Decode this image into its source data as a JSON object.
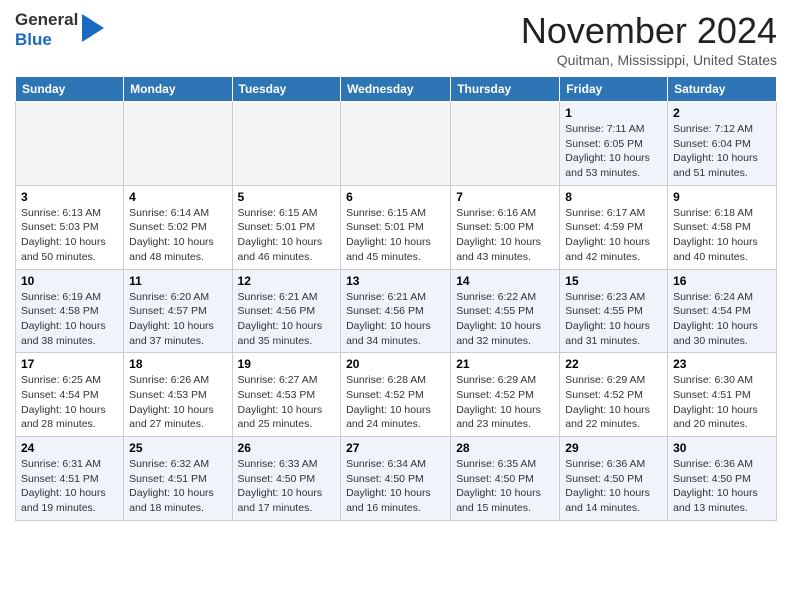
{
  "header": {
    "logo_general": "General",
    "logo_blue": "Blue",
    "month_title": "November 2024",
    "location": "Quitman, Mississippi, United States"
  },
  "days_of_week": [
    "Sunday",
    "Monday",
    "Tuesday",
    "Wednesday",
    "Thursday",
    "Friday",
    "Saturday"
  ],
  "weeks": [
    [
      {
        "day": "",
        "info": ""
      },
      {
        "day": "",
        "info": ""
      },
      {
        "day": "",
        "info": ""
      },
      {
        "day": "",
        "info": ""
      },
      {
        "day": "",
        "info": ""
      },
      {
        "day": "1",
        "info": "Sunrise: 7:11 AM\nSunset: 6:05 PM\nDaylight: 10 hours\nand 53 minutes."
      },
      {
        "day": "2",
        "info": "Sunrise: 7:12 AM\nSunset: 6:04 PM\nDaylight: 10 hours\nand 51 minutes."
      }
    ],
    [
      {
        "day": "3",
        "info": "Sunrise: 6:13 AM\nSunset: 5:03 PM\nDaylight: 10 hours\nand 50 minutes."
      },
      {
        "day": "4",
        "info": "Sunrise: 6:14 AM\nSunset: 5:02 PM\nDaylight: 10 hours\nand 48 minutes."
      },
      {
        "day": "5",
        "info": "Sunrise: 6:15 AM\nSunset: 5:01 PM\nDaylight: 10 hours\nand 46 minutes."
      },
      {
        "day": "6",
        "info": "Sunrise: 6:15 AM\nSunset: 5:01 PM\nDaylight: 10 hours\nand 45 minutes."
      },
      {
        "day": "7",
        "info": "Sunrise: 6:16 AM\nSunset: 5:00 PM\nDaylight: 10 hours\nand 43 minutes."
      },
      {
        "day": "8",
        "info": "Sunrise: 6:17 AM\nSunset: 4:59 PM\nDaylight: 10 hours\nand 42 minutes."
      },
      {
        "day": "9",
        "info": "Sunrise: 6:18 AM\nSunset: 4:58 PM\nDaylight: 10 hours\nand 40 minutes."
      }
    ],
    [
      {
        "day": "10",
        "info": "Sunrise: 6:19 AM\nSunset: 4:58 PM\nDaylight: 10 hours\nand 38 minutes."
      },
      {
        "day": "11",
        "info": "Sunrise: 6:20 AM\nSunset: 4:57 PM\nDaylight: 10 hours\nand 37 minutes."
      },
      {
        "day": "12",
        "info": "Sunrise: 6:21 AM\nSunset: 4:56 PM\nDaylight: 10 hours\nand 35 minutes."
      },
      {
        "day": "13",
        "info": "Sunrise: 6:21 AM\nSunset: 4:56 PM\nDaylight: 10 hours\nand 34 minutes."
      },
      {
        "day": "14",
        "info": "Sunrise: 6:22 AM\nSunset: 4:55 PM\nDaylight: 10 hours\nand 32 minutes."
      },
      {
        "day": "15",
        "info": "Sunrise: 6:23 AM\nSunset: 4:55 PM\nDaylight: 10 hours\nand 31 minutes."
      },
      {
        "day": "16",
        "info": "Sunrise: 6:24 AM\nSunset: 4:54 PM\nDaylight: 10 hours\nand 30 minutes."
      }
    ],
    [
      {
        "day": "17",
        "info": "Sunrise: 6:25 AM\nSunset: 4:54 PM\nDaylight: 10 hours\nand 28 minutes."
      },
      {
        "day": "18",
        "info": "Sunrise: 6:26 AM\nSunset: 4:53 PM\nDaylight: 10 hours\nand 27 minutes."
      },
      {
        "day": "19",
        "info": "Sunrise: 6:27 AM\nSunset: 4:53 PM\nDaylight: 10 hours\nand 25 minutes."
      },
      {
        "day": "20",
        "info": "Sunrise: 6:28 AM\nSunset: 4:52 PM\nDaylight: 10 hours\nand 24 minutes."
      },
      {
        "day": "21",
        "info": "Sunrise: 6:29 AM\nSunset: 4:52 PM\nDaylight: 10 hours\nand 23 minutes."
      },
      {
        "day": "22",
        "info": "Sunrise: 6:29 AM\nSunset: 4:52 PM\nDaylight: 10 hours\nand 22 minutes."
      },
      {
        "day": "23",
        "info": "Sunrise: 6:30 AM\nSunset: 4:51 PM\nDaylight: 10 hours\nand 20 minutes."
      }
    ],
    [
      {
        "day": "24",
        "info": "Sunrise: 6:31 AM\nSunset: 4:51 PM\nDaylight: 10 hours\nand 19 minutes."
      },
      {
        "day": "25",
        "info": "Sunrise: 6:32 AM\nSunset: 4:51 PM\nDaylight: 10 hours\nand 18 minutes."
      },
      {
        "day": "26",
        "info": "Sunrise: 6:33 AM\nSunset: 4:50 PM\nDaylight: 10 hours\nand 17 minutes."
      },
      {
        "day": "27",
        "info": "Sunrise: 6:34 AM\nSunset: 4:50 PM\nDaylight: 10 hours\nand 16 minutes."
      },
      {
        "day": "28",
        "info": "Sunrise: 6:35 AM\nSunset: 4:50 PM\nDaylight: 10 hours\nand 15 minutes."
      },
      {
        "day": "29",
        "info": "Sunrise: 6:36 AM\nSunset: 4:50 PM\nDaylight: 10 hours\nand 14 minutes."
      },
      {
        "day": "30",
        "info": "Sunrise: 6:36 AM\nSunset: 4:50 PM\nDaylight: 10 hours\nand 13 minutes."
      }
    ]
  ]
}
